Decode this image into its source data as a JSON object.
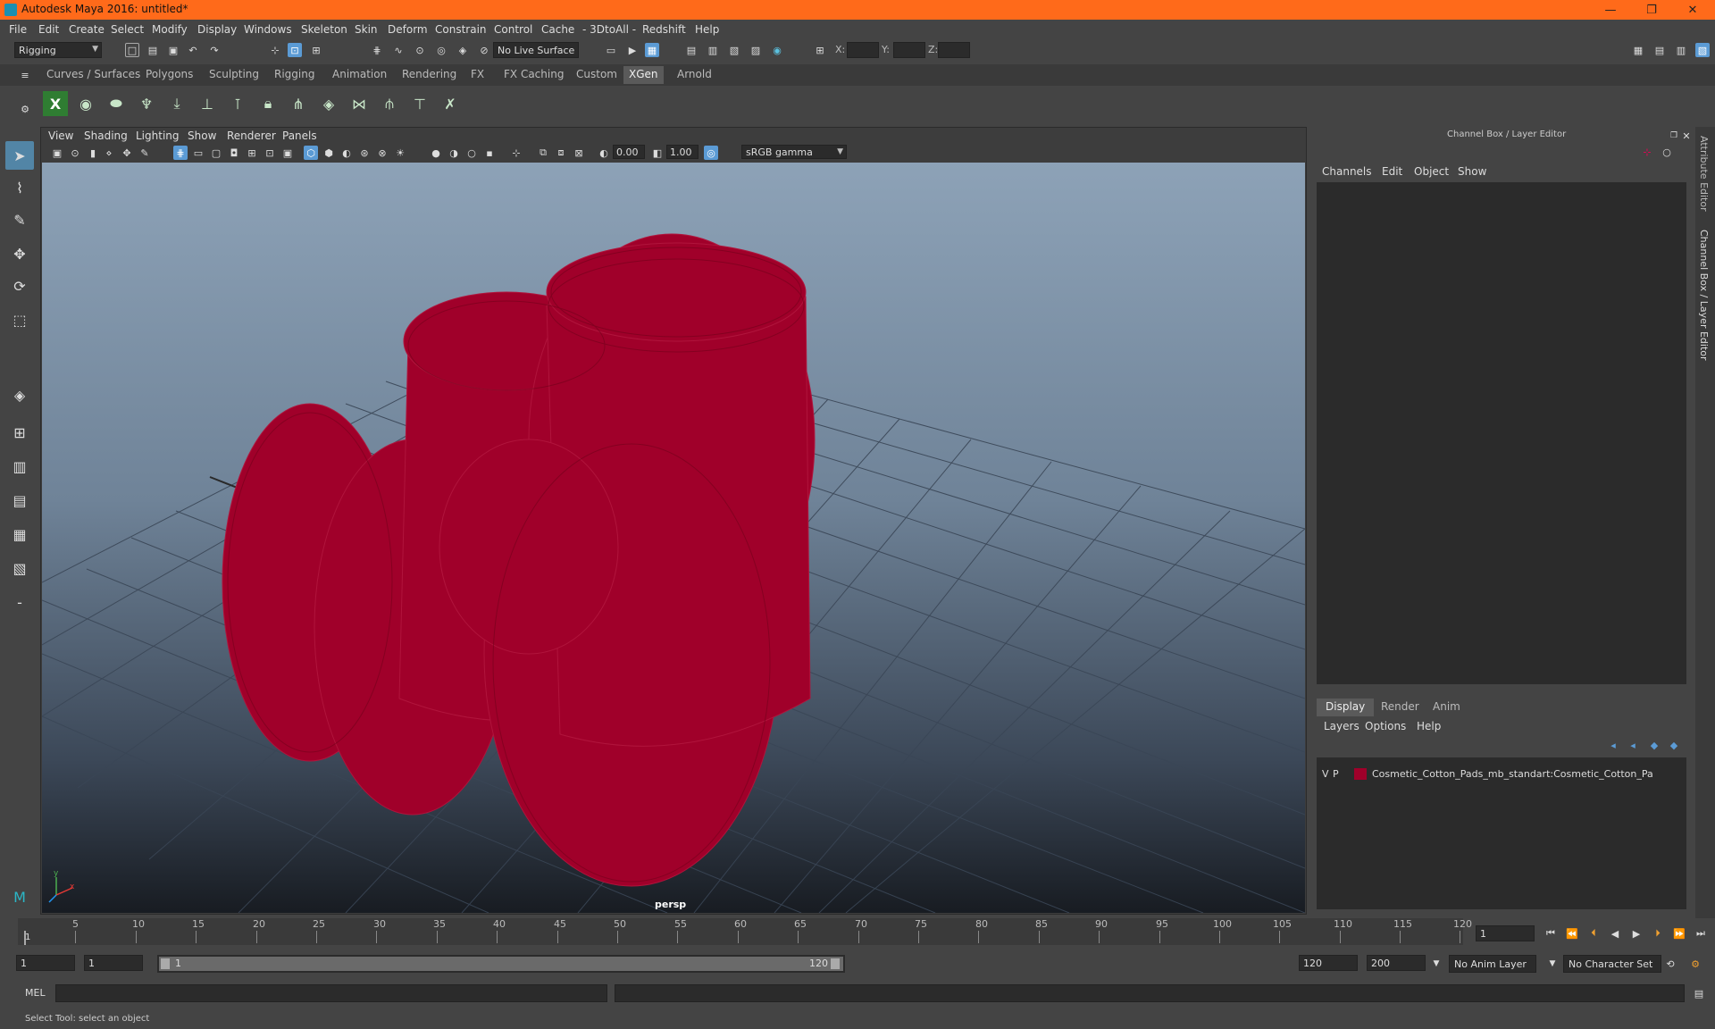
{
  "window": {
    "title": "Autodesk Maya 2016: untitled*",
    "minimize": "—",
    "restore": "❐",
    "close": "✕"
  },
  "menus": [
    "File",
    "Edit",
    "Create",
    "Select",
    "Modify",
    "Display",
    "Windows",
    "Skeleton",
    "Skin",
    "Deform",
    "Constrain",
    "Control",
    "Cache",
    "- 3DtoAll -",
    "Redshift",
    "Help"
  ],
  "status": {
    "menuset": "Rigging",
    "live_surface": "No Live Surface",
    "x_label": "X:",
    "y_label": "Y:",
    "z_label": "Z:"
  },
  "shelf_tabs": [
    "Curves / Surfaces",
    "Polygons",
    "Sculpting",
    "Rigging",
    "Animation",
    "Rendering",
    "FX",
    "FX Caching",
    "Custom",
    "XGen",
    "Arnold"
  ],
  "shelf_active": "XGen",
  "viewport": {
    "menus": [
      "View",
      "Shading",
      "Lighting",
      "Show",
      "Renderer",
      "Panels"
    ],
    "exposure": "0.00",
    "gamma": "1.00",
    "colorspace": "sRGB gamma",
    "camera": "persp",
    "axis_x": "x",
    "axis_y": "y"
  },
  "channelbox": {
    "title": "Channel Box / Layer Editor",
    "menus": [
      "Channels",
      "Edit",
      "Object",
      "Show"
    ],
    "layer_tabs": [
      "Display",
      "Render",
      "Anim"
    ],
    "layer_tab_active": "Display",
    "layer_menus": [
      "Layers",
      "Options",
      "Help"
    ],
    "layers": [
      {
        "v": "V",
        "p": "P",
        "color": "#a0002a",
        "name": "Cosmetic_Cotton_Pads_mb_standart:Cosmetic_Cotton_Pa"
      }
    ]
  },
  "side_tabs": [
    "Attribute Editor",
    "Channel Box / Layer Editor"
  ],
  "timeline": {
    "ticks": [
      "5",
      "10",
      "15",
      "20",
      "25",
      "30",
      "35",
      "40",
      "45",
      "50",
      "55",
      "60",
      "65",
      "70",
      "75",
      "80",
      "85",
      "90",
      "95",
      "100",
      "105",
      "110",
      "115",
      "120"
    ],
    "current_marker": "1",
    "current_frame": "1"
  },
  "range": {
    "start": "1",
    "playback_start": "1",
    "slider_start": "1",
    "slider_end": "120",
    "playback_end": "120",
    "end": "200",
    "anim_layer": "No Anim Layer",
    "character_set": "No Character Set"
  },
  "command": {
    "lang": "MEL"
  },
  "help_line": "Select Tool: select an object",
  "colors": {
    "title_bar": "#ff6a1a",
    "mesh": "#a0002a",
    "highlight": "#5285a6"
  }
}
